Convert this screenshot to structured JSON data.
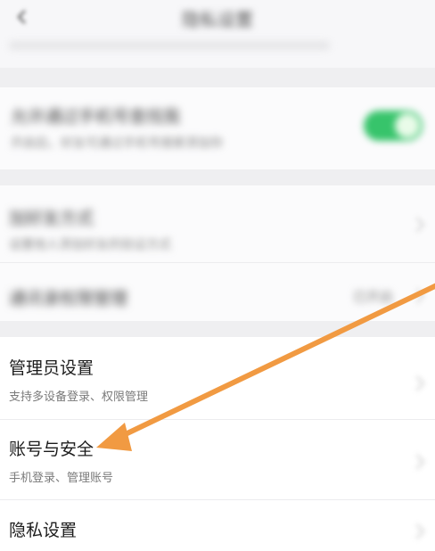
{
  "header": {
    "title": "隐私设置"
  },
  "section1": {
    "toggle_item": {
      "label": "允许通过手机号查找我",
      "hint": "开启后，好友可通过手机号搜索添加你",
      "toggle_on": true
    }
  },
  "section2": {
    "items": [
      {
        "label": "加好友方式",
        "hint": "设置他人添加好友的验证方式"
      },
      {
        "label": "通讯录权限管理",
        "value": "已开启"
      }
    ]
  },
  "section3": {
    "items": [
      {
        "label": "管理员设置",
        "hint": "支持多设备登录、权限管理"
      },
      {
        "label": "账号与安全",
        "hint": "手机登录、管理账号"
      },
      {
        "label": "隐私设置"
      }
    ]
  },
  "colors": {
    "toggle_on": "#37c46b",
    "annotation_arrow": "#f19a42",
    "page_bg": "#efeff1"
  },
  "icons": {
    "back": "back-chevron-icon",
    "row_arrow": "chevron-right-icon"
  }
}
